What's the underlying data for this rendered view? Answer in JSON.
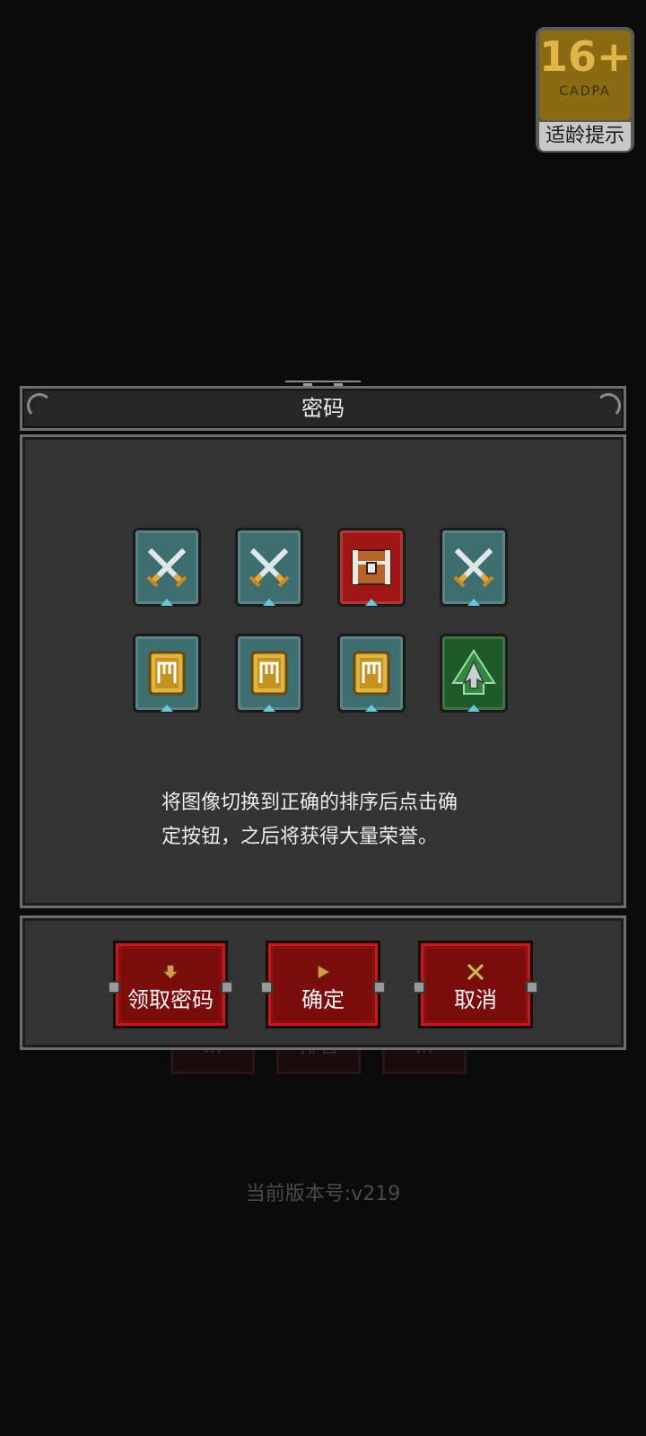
{
  "age_badge": {
    "rating": "16+",
    "org": "CADPA",
    "label": "适龄提示"
  },
  "dialog": {
    "title": "密码",
    "tiles": [
      {
        "icon": "crossed-swords-icon",
        "theme": "teal"
      },
      {
        "icon": "crossed-swords-icon",
        "theme": "teal"
      },
      {
        "icon": "treasure-chest-icon",
        "theme": "red"
      },
      {
        "icon": "crossed-swords-icon",
        "theme": "teal"
      },
      {
        "icon": "gold-banner-icon",
        "theme": "teal"
      },
      {
        "icon": "gold-banner-icon",
        "theme": "teal"
      },
      {
        "icon": "gold-banner-icon",
        "theme": "teal"
      },
      {
        "icon": "green-arrow-icon",
        "theme": "green"
      }
    ],
    "instructions_line1": "将图像切换到正确的排序后点击确",
    "instructions_line2": "定按钮，之后将获得大量荣誉。"
  },
  "buttons": {
    "get_code": "领取密码",
    "confirm": "确定",
    "cancel": "取消"
  },
  "background": {
    "version": "当前版本号:v219",
    "ghost_buttons": [
      "...",
      "排名",
      "..."
    ]
  },
  "colors": {
    "accent_red": "#a01616",
    "tile_teal": "#3f6e70",
    "tile_green": "#1f5a2a",
    "gold": "#d4a73b"
  }
}
